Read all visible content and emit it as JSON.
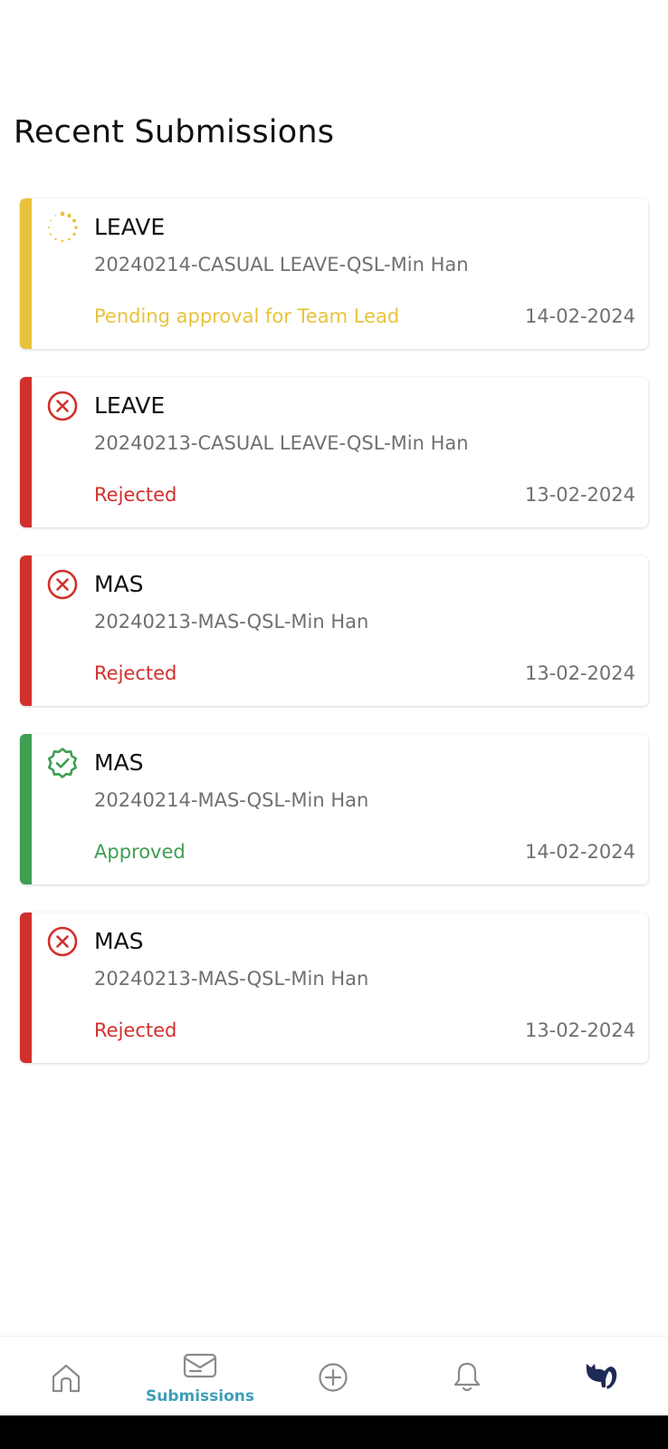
{
  "page": {
    "title": "Recent Submissions"
  },
  "colors": {
    "pending": "#e9c23b",
    "rejected": "#d2302c",
    "approved": "#3e9e52",
    "nav_active": "#3d9fb8",
    "nav_inactive": "#8a8a8a"
  },
  "submissions": [
    {
      "type": "LEAVE",
      "ref": "20240214-CASUAL LEAVE-QSL-Min Han",
      "status": "Pending approval for Team Lead",
      "date": "14-02-2024",
      "state": "pending",
      "icon": "spinner-icon"
    },
    {
      "type": "LEAVE",
      "ref": "20240213-CASUAL LEAVE-QSL-Min Han",
      "status": "Rejected",
      "date": "13-02-2024",
      "state": "rejected",
      "icon": "close-circle-icon"
    },
    {
      "type": "MAS",
      "ref": "20240213-MAS-QSL-Min Han",
      "status": "Rejected",
      "date": "13-02-2024",
      "state": "rejected",
      "icon": "close-circle-icon"
    },
    {
      "type": "MAS",
      "ref": "20240214-MAS-QSL-Min Han",
      "status": "Approved",
      "date": "14-02-2024",
      "state": "approved",
      "icon": "verified-badge-icon"
    },
    {
      "type": "MAS",
      "ref": "20240213-MAS-QSL-Min Han",
      "status": "Rejected",
      "date": "13-02-2024",
      "state": "rejected",
      "icon": "close-circle-icon"
    }
  ],
  "nav": {
    "items": [
      {
        "id": "home",
        "icon": "home-icon",
        "label": ""
      },
      {
        "id": "submissions",
        "icon": "envelope-icon",
        "label": "Submissions",
        "active": true
      },
      {
        "id": "add",
        "icon": "plus-circle-icon",
        "label": ""
      },
      {
        "id": "notifications",
        "icon": "bell-icon",
        "label": ""
      },
      {
        "id": "profile",
        "icon": "cat-avatar-icon",
        "label": ""
      }
    ]
  }
}
